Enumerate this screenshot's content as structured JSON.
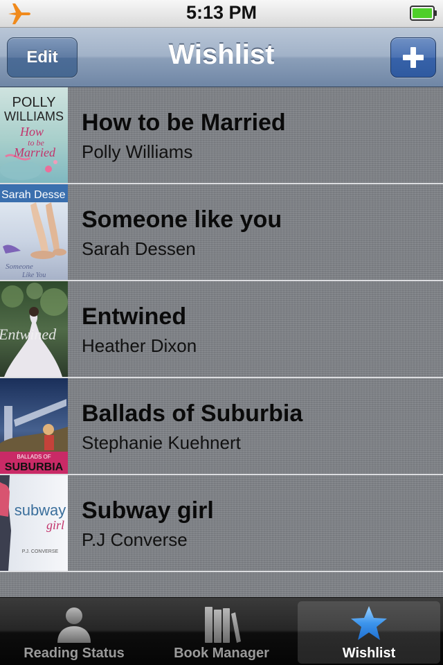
{
  "status_bar": {
    "time": "5:13 PM",
    "icons": [
      "airplane-icon",
      "battery-icon"
    ]
  },
  "nav": {
    "title": "Wishlist",
    "edit_label": "Edit",
    "add_icon": "plus-icon"
  },
  "books": [
    {
      "title": "How to be Married",
      "author": "Polly Williams",
      "cover_text": [
        "POLLY",
        "WILLIAMS",
        "How",
        "to be",
        "Married"
      ]
    },
    {
      "title": "Someone like you",
      "author": "Sarah Dessen",
      "cover_text": [
        "Sarah Desse",
        "Someone",
        "Like You"
      ]
    },
    {
      "title": "Entwined",
      "author": "Heather Dixon",
      "cover_text": [
        "Entwined"
      ]
    },
    {
      "title": "Ballads of Suburbia",
      "author": "Stephanie Kuehnert",
      "cover_text": [
        "BALLADS OF",
        "SUBURBIA"
      ]
    },
    {
      "title": "Subway girl",
      "author": "P.J Converse",
      "cover_text": [
        "subway",
        "girl",
        "P.J. CONVERSE"
      ]
    }
  ],
  "tabs": [
    {
      "label": "Reading Status",
      "icon": "person-icon",
      "selected": false
    },
    {
      "label": "Book Manager",
      "icon": "books-icon",
      "selected": false
    },
    {
      "label": "Wishlist",
      "icon": "star-icon",
      "selected": true
    }
  ],
  "colors": {
    "nav_bar": "#8b9fb9",
    "add_button": "#3762a9",
    "list_background": "#818489",
    "tab_bar": "#0d0d0d",
    "tab_selected_label": "#ffffff",
    "star_icon": "#3d95ec",
    "battery": "#4fcf2a"
  }
}
